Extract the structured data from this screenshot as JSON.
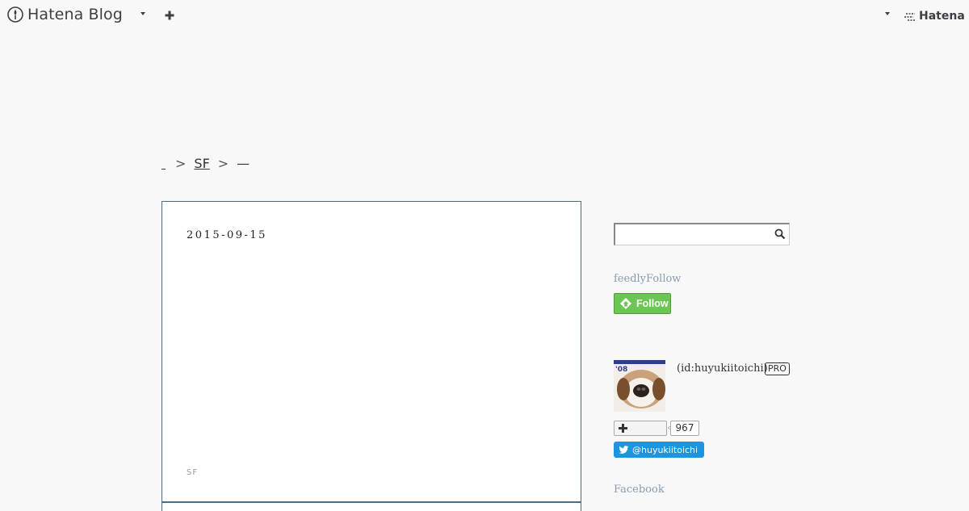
{
  "header": {
    "brand": "Hatena Blog",
    "hatena": "Hatena"
  },
  "breadcrumb": {
    "category": "SF",
    "separator": ">",
    "current": "—"
  },
  "article": {
    "date": "2015-09-15",
    "category": "SF"
  },
  "sidebar": {
    "search": {
      "placeholder": "",
      "value": ""
    },
    "feedly": {
      "title": "feedlyFollow",
      "button_label": "Follow"
    },
    "profile": {
      "id_text": "(id:huyukiitoichi)",
      "badge": "PRO",
      "subscribers": "967",
      "twitter_label": "@huyukiitoichi"
    },
    "facebook_title": "Facebook"
  },
  "colors": {
    "background": "#f8f8f8",
    "article_border": "#4f6b82",
    "feedly_green": "#6cc655",
    "twitter_blue": "#1b95e0",
    "widget_title": "#8a9bb0"
  }
}
